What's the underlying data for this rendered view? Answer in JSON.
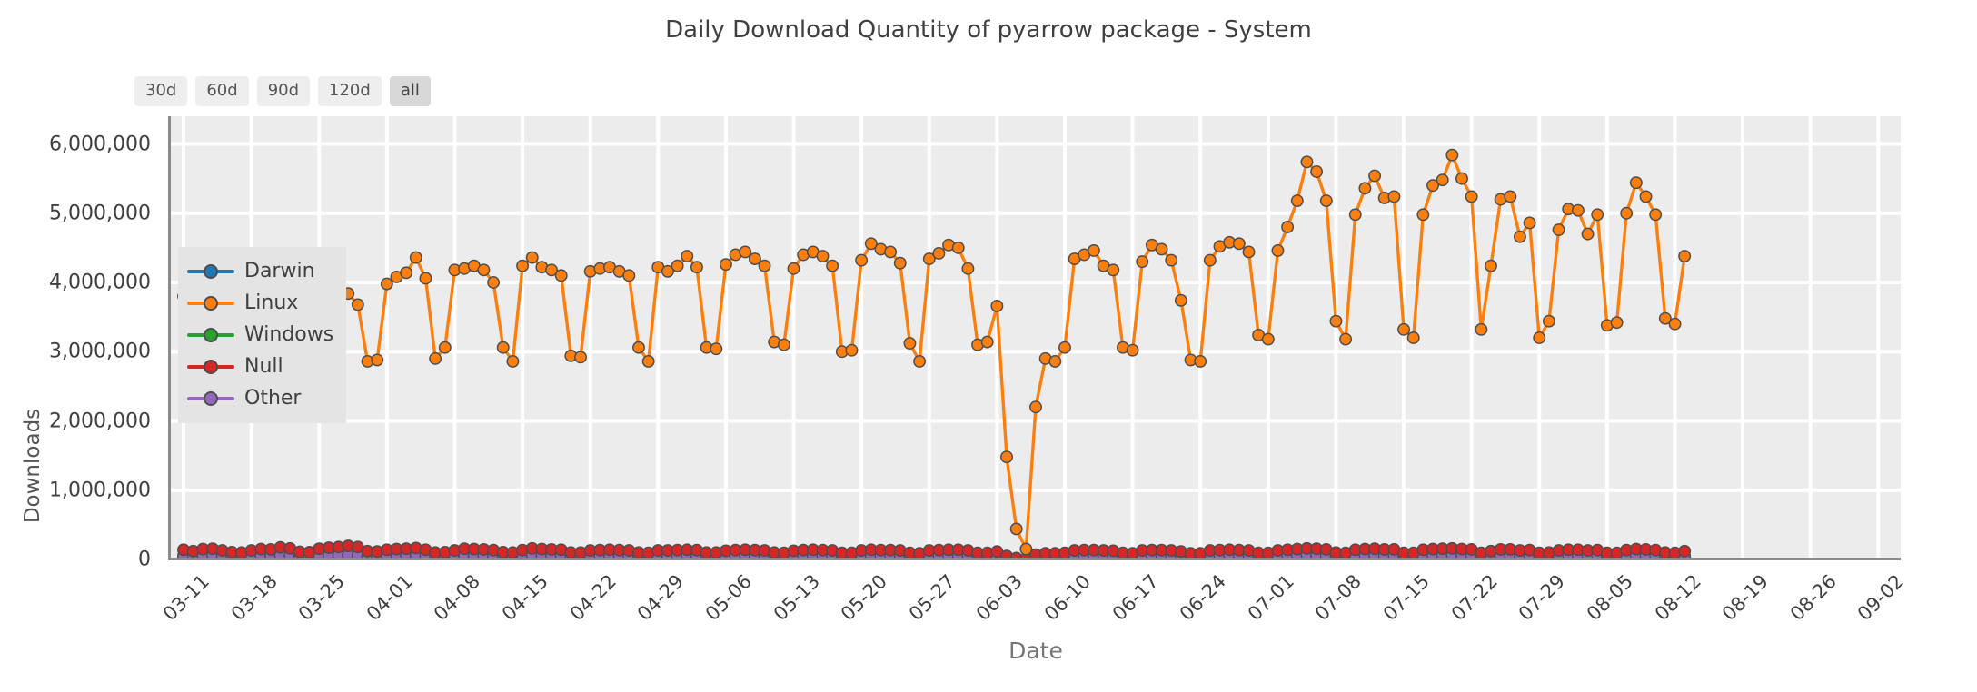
{
  "title": "Daily Download Quantity of pyarrow package - System",
  "range_buttons": [
    {
      "label": "30d",
      "active": false
    },
    {
      "label": "60d",
      "active": false
    },
    {
      "label": "90d",
      "active": false
    },
    {
      "label": "120d",
      "active": false
    },
    {
      "label": "all",
      "active": true
    }
  ],
  "axes": {
    "ylabel": "Downloads",
    "xlabel": "Date",
    "ytick_labels": [
      "0",
      "1,000,000",
      "2,000,000",
      "3,000,000",
      "4,000,000",
      "5,000,000",
      "6,000,000"
    ],
    "ytick_values": [
      0,
      1000000,
      2000000,
      3000000,
      4000000,
      5000000,
      6000000
    ],
    "ylim": [
      0,
      6400000
    ],
    "grid": true,
    "plot_bg": "#ececec",
    "grid_color": "#ffffff"
  },
  "legend": {
    "position": "center-left",
    "entries": [
      {
        "label": "Darwin",
        "color": "#1f77b4"
      },
      {
        "label": "Linux",
        "color": "#ff7f0e"
      },
      {
        "label": "Windows",
        "color": "#2ca02c"
      },
      {
        "label": "Null",
        "color": "#d62728"
      },
      {
        "label": "Other",
        "color": "#9467bd"
      }
    ]
  },
  "chart_data": {
    "type": "line",
    "title": "Daily Download Quantity of pyarrow package - System",
    "xlabel": "Date",
    "ylabel": "Downloads",
    "ylim": [
      0,
      6400000
    ],
    "grid": true,
    "legend_position": "center-left",
    "marker": "circle",
    "x_tick_labels": [
      "03-11",
      "03-18",
      "03-25",
      "04-01",
      "04-08",
      "04-15",
      "04-22",
      "04-29",
      "05-06",
      "05-13",
      "05-20",
      "05-27",
      "06-03",
      "06-10",
      "06-17",
      "06-24",
      "07-01",
      "07-08",
      "07-15",
      "07-22",
      "07-29",
      "08-05",
      "08-12",
      "08-19",
      "08-26",
      "09-02"
    ],
    "x_tick_indices": [
      0,
      7,
      14,
      21,
      28,
      35,
      42,
      49,
      56,
      63,
      70,
      77,
      84,
      91,
      98,
      105,
      112,
      119,
      126,
      133,
      140,
      147,
      154,
      161,
      168,
      175
    ],
    "x": [
      "03-11",
      "03-12",
      "03-13",
      "03-14",
      "03-15",
      "03-16",
      "03-17",
      "03-18",
      "03-19",
      "03-20",
      "03-21",
      "03-22",
      "03-23",
      "03-24",
      "03-25",
      "03-26",
      "03-27",
      "03-28",
      "03-29",
      "03-30",
      "03-31",
      "04-01",
      "04-02",
      "04-03",
      "04-04",
      "04-05",
      "04-06",
      "04-07",
      "04-08",
      "04-09",
      "04-10",
      "04-11",
      "04-12",
      "04-13",
      "04-14",
      "04-15",
      "04-16",
      "04-17",
      "04-18",
      "04-19",
      "04-20",
      "04-21",
      "04-22",
      "04-23",
      "04-24",
      "04-25",
      "04-26",
      "04-27",
      "04-28",
      "04-29",
      "04-30",
      "05-01",
      "05-02",
      "05-03",
      "05-04",
      "05-05",
      "05-06",
      "05-07",
      "05-08",
      "05-09",
      "05-10",
      "05-11",
      "05-12",
      "05-13",
      "05-14",
      "05-15",
      "05-16",
      "05-17",
      "05-18",
      "05-19",
      "05-20",
      "05-21",
      "05-22",
      "05-23",
      "05-24",
      "05-25",
      "05-26",
      "05-27",
      "05-28",
      "05-29",
      "05-30",
      "05-31",
      "06-01",
      "06-02",
      "06-03",
      "06-04",
      "06-05",
      "06-06",
      "06-07",
      "06-08",
      "06-09",
      "06-10",
      "06-11",
      "06-12",
      "06-13",
      "06-14",
      "06-15",
      "06-16",
      "06-17",
      "06-18",
      "06-19",
      "06-20",
      "06-21",
      "06-22",
      "06-23",
      "06-24",
      "06-25",
      "06-26",
      "06-27",
      "06-28",
      "06-29",
      "06-30",
      "07-01",
      "07-02",
      "07-03",
      "07-04",
      "07-05",
      "07-06",
      "07-07",
      "07-08",
      "07-09",
      "07-10",
      "07-11",
      "07-12",
      "07-13",
      "07-14",
      "07-15",
      "07-16",
      "07-17",
      "07-18",
      "07-19",
      "07-20",
      "07-21",
      "07-22",
      "07-23",
      "07-24",
      "07-25",
      "07-26",
      "07-27",
      "07-28",
      "07-29",
      "07-30",
      "07-31",
      "08-01",
      "08-02",
      "08-03",
      "08-04",
      "08-05",
      "08-06",
      "08-07",
      "08-08",
      "08-09",
      "08-10",
      "08-11",
      "08-12",
      "08-13",
      "08-14",
      "08-15",
      "08-16",
      "08-17",
      "08-18",
      "08-19",
      "08-20",
      "08-21",
      "08-22",
      "08-23",
      "08-24",
      "08-25",
      "08-26",
      "08-27",
      "08-28",
      "08-29",
      "08-30",
      "08-31",
      "09-01",
      "09-02",
      "09-03"
    ],
    "series": [
      {
        "name": "Linux",
        "color": "#ff7f0e",
        "values": [
          3800000,
          3700000,
          4200000,
          4160000,
          3460000,
          2700000,
          2740000,
          3580000,
          3960000,
          4040000,
          3960000,
          3640000,
          2740000,
          2680000,
          3680000,
          3860000,
          3900000,
          3840000,
          3680000,
          2860000,
          2880000,
          3980000,
          4080000,
          4140000,
          4360000,
          4060000,
          2900000,
          3060000,
          4180000,
          4200000,
          4240000,
          4180000,
          4000000,
          3060000,
          2860000,
          4240000,
          4360000,
          4220000,
          4180000,
          4100000,
          2940000,
          2920000,
          4160000,
          4200000,
          4220000,
          4160000,
          4100000,
          3060000,
          2860000,
          4220000,
          4160000,
          4240000,
          4380000,
          4220000,
          3060000,
          3040000,
          4260000,
          4400000,
          4440000,
          4340000,
          4240000,
          3140000,
          3100000,
          4200000,
          4400000,
          4440000,
          4380000,
          4240000,
          3000000,
          3020000,
          4320000,
          4560000,
          4480000,
          4440000,
          4280000,
          3120000,
          2860000,
          4340000,
          4420000,
          4540000,
          4500000,
          4200000,
          3100000,
          3140000,
          3660000,
          1480000,
          440000,
          150000,
          2200000,
          2900000,
          2860000,
          3060000,
          4340000,
          4400000,
          4460000,
          4240000,
          4180000,
          3060000,
          3020000,
          4300000,
          4540000,
          4480000,
          4320000,
          3740000,
          2880000,
          2860000,
          4320000,
          4520000,
          4580000,
          4560000,
          4440000,
          3240000,
          3180000,
          4460000,
          4800000,
          5180000,
          5740000,
          5600000,
          5180000,
          3440000,
          3180000,
          4980000,
          5360000,
          5540000,
          5220000,
          5240000,
          3320000,
          3200000,
          4980000,
          5400000,
          5480000,
          5840000,
          5500000,
          5240000,
          3320000,
          4240000,
          5200000,
          5240000,
          4660000,
          4860000,
          3200000,
          3440000,
          4760000,
          5060000,
          5040000,
          4700000,
          4980000,
          3380000,
          3420000,
          5000000,
          5440000,
          5240000,
          4980000,
          3480000,
          3400000,
          4380000
        ]
      },
      {
        "name": "Null",
        "color": "#d62728",
        "values": [
          140000,
          120000,
          150000,
          155000,
          130000,
          105000,
          100000,
          130000,
          150000,
          145000,
          175000,
          160000,
          110000,
          105000,
          155000,
          170000,
          180000,
          195000,
          180000,
          120000,
          115000,
          140000,
          150000,
          155000,
          165000,
          140000,
          100000,
          105000,
          130000,
          155000,
          150000,
          145000,
          135000,
          105000,
          100000,
          135000,
          160000,
          150000,
          145000,
          140000,
          100000,
          100000,
          130000,
          135000,
          140000,
          135000,
          130000,
          100000,
          95000,
          130000,
          130000,
          135000,
          140000,
          135000,
          100000,
          100000,
          125000,
          135000,
          140000,
          135000,
          130000,
          100000,
          95000,
          125000,
          135000,
          140000,
          135000,
          130000,
          95000,
          95000,
          130000,
          140000,
          135000,
          135000,
          130000,
          95000,
          90000,
          130000,
          135000,
          140000,
          140000,
          130000,
          95000,
          95000,
          115000,
          50000,
          20000,
          10000,
          70000,
          90000,
          90000,
          95000,
          130000,
          135000,
          135000,
          130000,
          125000,
          95000,
          90000,
          130000,
          135000,
          135000,
          130000,
          115000,
          90000,
          90000,
          130000,
          135000,
          140000,
          135000,
          130000,
          95000,
          95000,
          130000,
          140000,
          150000,
          160000,
          155000,
          145000,
          100000,
          95000,
          140000,
          150000,
          155000,
          145000,
          145000,
          95000,
          95000,
          140000,
          150000,
          155000,
          160000,
          150000,
          145000,
          95000,
          120000,
          145000,
          145000,
          130000,
          135000,
          95000,
          100000,
          130000,
          140000,
          140000,
          130000,
          135000,
          95000,
          95000,
          135000,
          150000,
          145000,
          135000,
          100000,
          95000,
          120000
        ]
      },
      {
        "name": "Other",
        "color": "#9467bd",
        "values": [
          55000,
          50000,
          58000,
          60000,
          50000,
          42000,
          40000,
          52000,
          58000,
          58000,
          60000,
          55000,
          42000,
          40000,
          56000,
          60000,
          62000,
          62000,
          58000,
          44000,
          43000,
          54000,
          58000,
          60000,
          62000,
          55000,
          40000,
          42000,
          52000,
          58000,
          58000,
          56000,
          52000,
          42000,
          40000,
          52000,
          60000,
          58000,
          56000,
          54000,
          40000,
          40000,
          52000,
          54000,
          56000,
          54000,
          52000,
          40000,
          38000,
          52000,
          52000,
          54000,
          56000,
          54000,
          40000,
          40000,
          50000,
          54000,
          56000,
          54000,
          52000,
          40000,
          38000,
          50000,
          54000,
          56000,
          54000,
          52000,
          38000,
          38000,
          52000,
          56000,
          54000,
          54000,
          52000,
          38000,
          36000,
          52000,
          54000,
          56000,
          56000,
          52000,
          38000,
          38000,
          46000,
          20000,
          8000,
          4000,
          28000,
          36000,
          36000,
          38000,
          52000,
          54000,
          54000,
          52000,
          50000,
          38000,
          36000,
          52000,
          54000,
          54000,
          52000,
          46000,
          36000,
          36000,
          52000,
          54000,
          56000,
          54000,
          52000,
          38000,
          38000,
          52000,
          56000,
          60000,
          64000,
          62000,
          58000,
          40000,
          38000,
          56000,
          60000,
          62000,
          58000,
          58000,
          38000,
          38000,
          56000,
          60000,
          62000,
          64000,
          60000,
          58000,
          38000,
          48000,
          58000,
          58000,
          52000,
          54000,
          38000,
          40000,
          52000,
          56000,
          56000,
          52000,
          54000,
          38000,
          38000,
          54000,
          60000,
          58000,
          54000,
          40000,
          38000,
          48000
        ]
      },
      {
        "name": "Windows",
        "color": "#2ca02c",
        "values": [
          38000,
          34000,
          40000,
          42000,
          34000,
          28000,
          27000,
          36000,
          40000,
          40000,
          42000,
          38000,
          28000,
          27000,
          38000,
          42000,
          43000,
          43000,
          40000,
          30000,
          29000,
          37000,
          40000,
          42000,
          43000,
          38000,
          27000,
          29000,
          36000,
          40000,
          40000,
          38000,
          36000,
          29000,
          27000,
          36000,
          42000,
          40000,
          38000,
          37000,
          27000,
          27000,
          36000,
          37000,
          38000,
          37000,
          36000,
          27000,
          26000,
          36000,
          36000,
          37000,
          38000,
          37000,
          27000,
          27000,
          34000,
          37000,
          38000,
          37000,
          36000,
          27000,
          26000,
          34000,
          37000,
          38000,
          37000,
          36000,
          26000,
          26000,
          36000,
          38000,
          37000,
          37000,
          36000,
          26000,
          25000,
          36000,
          37000,
          38000,
          38000,
          36000,
          26000,
          26000,
          32000,
          14000,
          6000,
          3000,
          19000,
          25000,
          25000,
          26000,
          36000,
          37000,
          37000,
          36000,
          34000,
          26000,
          25000,
          36000,
          37000,
          37000,
          36000,
          32000,
          25000,
          25000,
          36000,
          37000,
          38000,
          37000,
          36000,
          26000,
          26000,
          36000,
          38000,
          41000,
          44000,
          43000,
          40000,
          28000,
          26000,
          38000,
          41000,
          43000,
          40000,
          40000,
          26000,
          26000,
          38000,
          41000,
          43000,
          44000,
          41000,
          40000,
          26000,
          33000,
          40000,
          40000,
          36000,
          37000,
          26000,
          28000,
          36000,
          38000,
          38000,
          36000,
          37000,
          26000,
          26000,
          37000,
          41000,
          40000,
          37000,
          28000,
          26000,
          33000
        ]
      },
      {
        "name": "Darwin",
        "color": "#1f77b4",
        "values": [
          26000,
          23000,
          27000,
          28000,
          23000,
          19000,
          18000,
          24000,
          27000,
          27000,
          28000,
          26000,
          19000,
          18000,
          26000,
          28000,
          29000,
          29000,
          27000,
          20000,
          20000,
          25000,
          27000,
          28000,
          29000,
          26000,
          18000,
          20000,
          24000,
          27000,
          27000,
          26000,
          24000,
          20000,
          18000,
          24000,
          28000,
          27000,
          26000,
          25000,
          18000,
          18000,
          24000,
          25000,
          26000,
          25000,
          24000,
          18000,
          17000,
          24000,
          24000,
          25000,
          26000,
          25000,
          18000,
          18000,
          23000,
          25000,
          26000,
          25000,
          24000,
          18000,
          17000,
          23000,
          25000,
          26000,
          25000,
          24000,
          17000,
          17000,
          24000,
          26000,
          25000,
          25000,
          24000,
          17000,
          17000,
          24000,
          25000,
          26000,
          26000,
          24000,
          17000,
          17000,
          21000,
          9000,
          4000,
          2000,
          13000,
          17000,
          17000,
          18000,
          24000,
          25000,
          25000,
          24000,
          23000,
          17000,
          17000,
          24000,
          25000,
          25000,
          24000,
          21000,
          17000,
          17000,
          24000,
          25000,
          26000,
          25000,
          24000,
          18000,
          18000,
          24000,
          26000,
          27000,
          29000,
          28000,
          26000,
          19000,
          17000,
          26000,
          27000,
          28000,
          26000,
          26000,
          17000,
          17000,
          26000,
          27000,
          28000,
          29000,
          27000,
          26000,
          17000,
          22000,
          27000,
          27000,
          24000,
          25000,
          17000,
          19000,
          24000,
          26000,
          26000,
          24000,
          25000,
          17000,
          17000,
          25000,
          27000,
          26000,
          25000,
          19000,
          17000,
          22000
        ]
      }
    ]
  }
}
